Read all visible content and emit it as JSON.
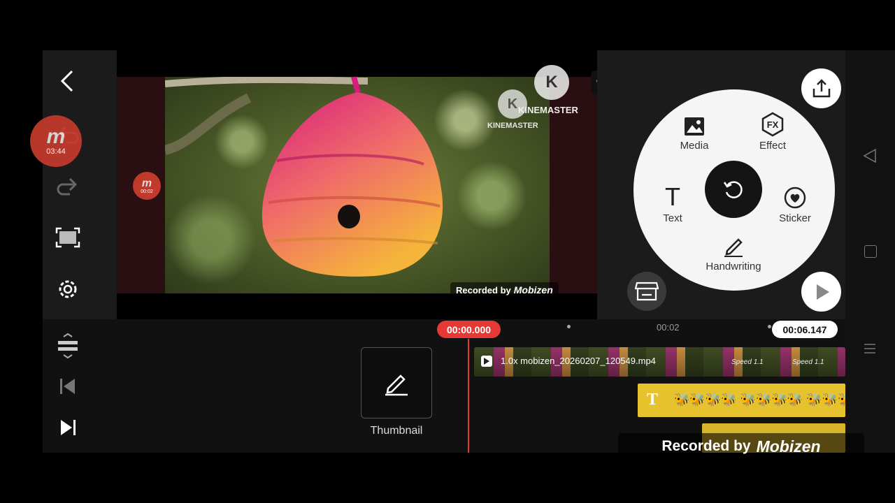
{
  "toolbar": {
    "back_icon": "chevron-left-icon",
    "undo_icon": "undo-icon",
    "redo_icon": "redo-icon",
    "fullscreen_icon": "fullscreen-icon",
    "settings_icon": "gear-icon"
  },
  "mobizen_bubble": {
    "label": "03:44"
  },
  "mobizen_small": {
    "label": "00:02"
  },
  "preview": {
    "kinemaster_logo": "KINEMASTER",
    "kinemaster_watermark": "KINEMASTER",
    "recorded_by": "Recorded by",
    "mobizen_text": "Mobizen"
  },
  "menu": {
    "media": "Media",
    "effect": "Effect",
    "text": "Text",
    "sticker": "Sticker",
    "handwriting": "Handwriting",
    "effect_glyph": "FX",
    "text_glyph": "T"
  },
  "timeline": {
    "current_time": "00:00.000",
    "marker_label": "00:02",
    "total_time": "00:06.147",
    "thumbnail_label": "Thumbnail",
    "clip_name": "1.0x mobizen_20260207_120549.mp4",
    "speed_label_1": "Speed 1.1",
    "speed_label_2": "Speed 1.1",
    "text_layer_icon": "T",
    "text_layer_content": "🐝🐝🐝🐝 🐝🐝🐝🐝 🐝🐝🐝"
  },
  "recorder_watermark": {
    "prefix": "Recorded by",
    "brand": "Mobizen"
  },
  "colors": {
    "accent_red": "#e53935",
    "text_track": "#e7c22f",
    "panel_bg": "#1b1b1b"
  }
}
